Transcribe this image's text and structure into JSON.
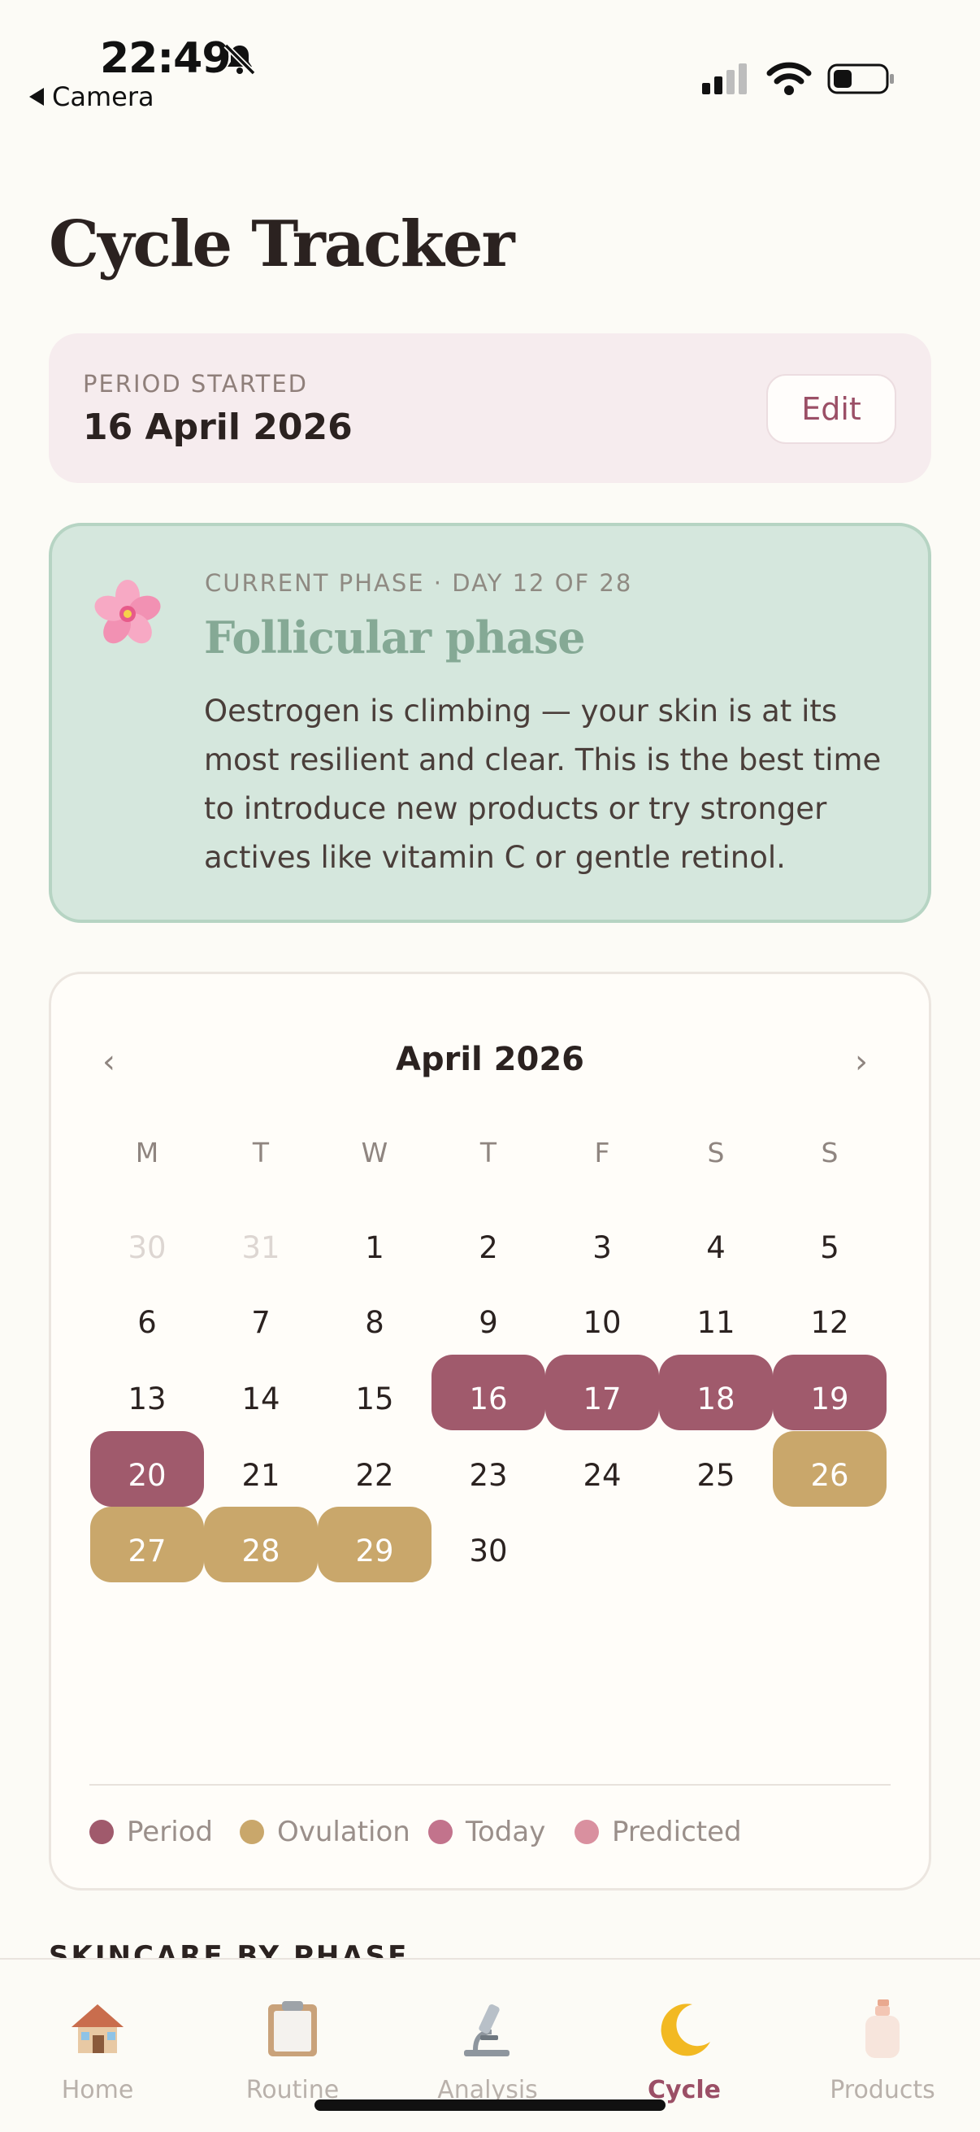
{
  "status_bar": {
    "time": "22:49",
    "back_label": "Camera"
  },
  "page": {
    "title": "Cycle Tracker"
  },
  "period": {
    "label": "PERIOD STARTED",
    "date": "16 April 2026",
    "edit_label": "Edit"
  },
  "phase": {
    "label": "CURRENT PHASE · DAY 12 OF 28",
    "name": "Follicular phase",
    "description": "Oestrogen is climbing — your skin is at its most resilient and clear. This is the best time to introduce new products or try stronger actives like vitamin C or gentle retinol.",
    "icon": "cherry-blossom-icon"
  },
  "calendar": {
    "month": "April 2026",
    "prev_label": "‹",
    "next_label": "›",
    "weekdays": [
      "M",
      "T",
      "W",
      "T",
      "F",
      "S",
      "S"
    ],
    "weeks": [
      [
        {
          "d": "30",
          "s": "muted"
        },
        {
          "d": "31",
          "s": "muted"
        },
        {
          "d": "1",
          "s": ""
        },
        {
          "d": "2",
          "s": ""
        },
        {
          "d": "3",
          "s": ""
        },
        {
          "d": "4",
          "s": ""
        },
        {
          "d": "5",
          "s": ""
        }
      ],
      [
        {
          "d": "6",
          "s": ""
        },
        {
          "d": "7",
          "s": ""
        },
        {
          "d": "8",
          "s": ""
        },
        {
          "d": "9",
          "s": ""
        },
        {
          "d": "10",
          "s": ""
        },
        {
          "d": "11",
          "s": ""
        },
        {
          "d": "12",
          "s": ""
        }
      ],
      [
        {
          "d": "13",
          "s": ""
        },
        {
          "d": "14",
          "s": ""
        },
        {
          "d": "15",
          "s": ""
        },
        {
          "d": "16",
          "s": "period"
        },
        {
          "d": "17",
          "s": "period"
        },
        {
          "d": "18",
          "s": "period"
        },
        {
          "d": "19",
          "s": "period"
        }
      ],
      [
        {
          "d": "20",
          "s": "period"
        },
        {
          "d": "21",
          "s": ""
        },
        {
          "d": "22",
          "s": ""
        },
        {
          "d": "23",
          "s": ""
        },
        {
          "d": "24",
          "s": ""
        },
        {
          "d": "25",
          "s": ""
        },
        {
          "d": "26",
          "s": "ovul"
        }
      ],
      [
        {
          "d": "27",
          "s": "ovul"
        },
        {
          "d": "28",
          "s": "ovul"
        },
        {
          "d": "29",
          "s": "ovul"
        },
        {
          "d": "30",
          "s": ""
        }
      ]
    ],
    "legend": [
      {
        "label": "Period",
        "color": "#a05a6c"
      },
      {
        "label": "Ovulation",
        "color": "#c9a76b"
      },
      {
        "label": "Today",
        "color": "#c2738c"
      },
      {
        "label": "Predicted",
        "color": "#d9909f"
      }
    ]
  },
  "section": {
    "next_heading": "SKINCARE BY PHASE"
  },
  "tabs": [
    {
      "label": "Home",
      "icon": "house-icon",
      "active": false
    },
    {
      "label": "Routine",
      "icon": "clipboard-icon",
      "active": false
    },
    {
      "label": "Analysis",
      "icon": "microscope-icon",
      "active": false
    },
    {
      "label": "Cycle",
      "icon": "crescent-moon-icon",
      "active": true
    },
    {
      "label": "Products",
      "icon": "lotion-bottle-icon",
      "active": false
    }
  ]
}
